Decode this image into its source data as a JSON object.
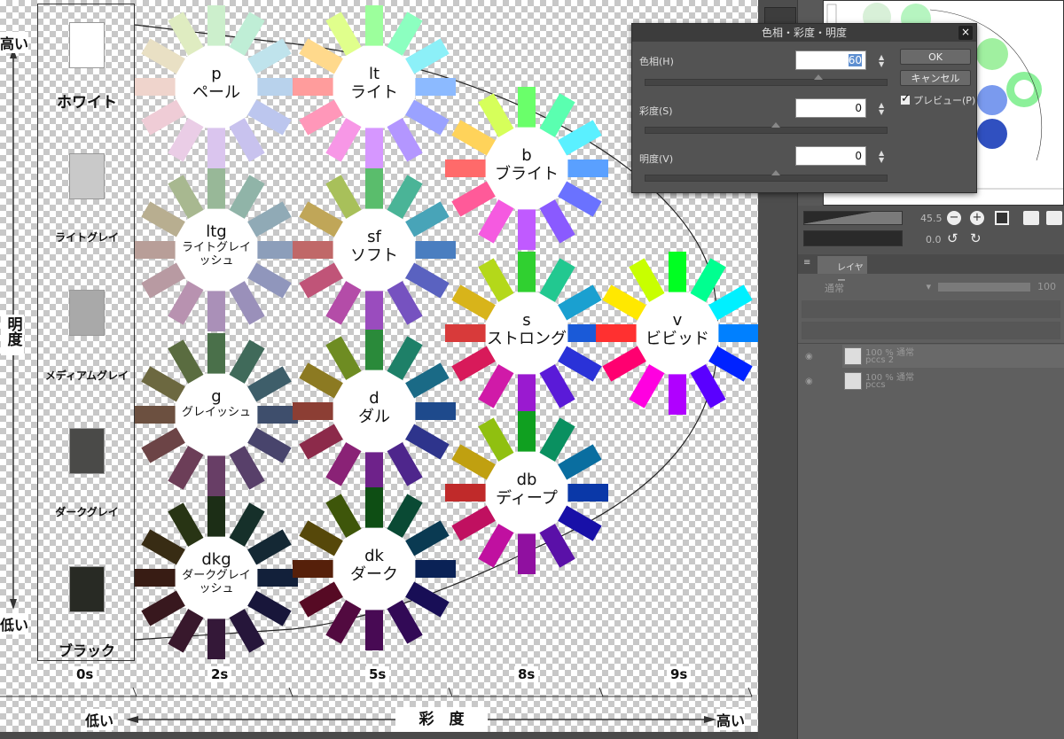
{
  "canvas": {
    "brightness_axis": {
      "high": "高い",
      "low": "低い",
      "label": "明度"
    },
    "saturation_axis": {
      "low": "低い",
      "high": "高い",
      "label": "彩　度"
    },
    "scale_labels": [
      "0s",
      "2s",
      "5s",
      "8s",
      "9s"
    ],
    "grays": [
      {
        "label": "ホワイト",
        "color": "#ffffff"
      },
      {
        "label": "ライトグレイ",
        "color": "#c9c9c9"
      },
      {
        "label": "メディアムグレイ",
        "color": "#a9a9a9"
      },
      {
        "label": "ダークグレイ",
        "color": "#4a4a48"
      },
      {
        "label": "ブラック",
        "color": "#282a24"
      }
    ],
    "tones": [
      {
        "code": "p",
        "name": "ペール",
        "colors": [
          "#ccefcc",
          "#bfeed6",
          "#bfe3ec",
          "#b8d2ec",
          "#bcc6ee",
          "#c8c2ee",
          "#dac5ee",
          "#eacde6",
          "#efccd6",
          "#efd4cc",
          "#e9e0c4",
          "#dfecc1"
        ]
      },
      {
        "code": "lt",
        "name": "ライト",
        "colors": [
          "#9cff9c",
          "#8cffc0",
          "#8cf0f8",
          "#8cbaff",
          "#9aa2ff",
          "#b396ff",
          "#d697ff",
          "#f797e6",
          "#ff97b9",
          "#ff9c9c",
          "#ffd98c",
          "#e0ff8c"
        ]
      },
      {
        "code": "b",
        "name": "ブライト",
        "colors": [
          "#6aff6a",
          "#5affb0",
          "#5af0ff",
          "#5aa0ff",
          "#6a72ff",
          "#8a5aff",
          "#c05aff",
          "#f55ae0",
          "#ff5a99",
          "#ff6a6a",
          "#ffd35a",
          "#d6ff5a"
        ]
      },
      {
        "code": "ltg",
        "name": "ライトグレイッシュ",
        "small": true,
        "colors": [
          "#98b898",
          "#90b4a8",
          "#90aab6",
          "#8c9eba",
          "#9096bc",
          "#9a90ba",
          "#aa90b8",
          "#b892b0",
          "#b89aa2",
          "#b89e98",
          "#b8ae90",
          "#a8b890"
        ]
      },
      {
        "code": "sf",
        "name": "ソフト",
        "colors": [
          "#5abd6c",
          "#4ab497",
          "#48a4b8",
          "#4a7ec0",
          "#5a62c0",
          "#7652c0",
          "#9a4cbe",
          "#b44ca8",
          "#c05478",
          "#c06868",
          "#c0a658",
          "#a8c05a"
        ]
      },
      {
        "code": "s",
        "name": "ストロング",
        "colors": [
          "#30d030",
          "#22c890",
          "#1aa0d0",
          "#1a5ad8",
          "#2a32d8",
          "#5a1ad8",
          "#9a1ad0",
          "#d01aa8",
          "#d81a5a",
          "#d83a3a",
          "#d8b41a",
          "#b4d81a"
        ]
      },
      {
        "code": "v",
        "name": "ビビッド",
        "colors": [
          "#00ff22",
          "#00ff90",
          "#00f0ff",
          "#0080ff",
          "#0022ff",
          "#5a00ff",
          "#b000ff",
          "#ff00e0",
          "#ff0070",
          "#ff3030",
          "#ffe800",
          "#c8ff00"
        ]
      },
      {
        "code": "g",
        "name": "グレイッシュ",
        "small": true,
        "colors": [
          "#4a704a",
          "#406a5a",
          "#3e5e6a",
          "#3e4e6c",
          "#48446c",
          "#58406a",
          "#683e66",
          "#6c3e58",
          "#6c4446",
          "#6c5040",
          "#6c6840",
          "#5a6c40"
        ]
      },
      {
        "code": "d",
        "name": "ダル",
        "colors": [
          "#2a8a3a",
          "#1e8068",
          "#1a6a86",
          "#1e4a8c",
          "#2e348c",
          "#4e268c",
          "#6e228a",
          "#8a2276",
          "#8c2a4a",
          "#8c3e34",
          "#8c7a22",
          "#6e8c22"
        ]
      },
      {
        "code": "db",
        "name": "ディープ",
        "colors": [
          "#10a020",
          "#0a9060",
          "#0a6ea0",
          "#0a38a8",
          "#1810a8",
          "#5a10a8",
          "#9010a0",
          "#c010a0",
          "#c01060",
          "#c02a2a",
          "#c0a010",
          "#90c010"
        ]
      },
      {
        "code": "dkg",
        "name": "ダークグレイッシュ",
        "small": true,
        "colors": [
          "#1c2e16",
          "#16302a",
          "#142834",
          "#12203a",
          "#18163a",
          "#26163a",
          "#341838",
          "#38182c",
          "#38181e",
          "#381c14",
          "#382c14",
          "#283414"
        ]
      },
      {
        "code": "dk",
        "name": "ダーク",
        "colors": [
          "#0e4e14",
          "#0a4a34",
          "#0a3a52",
          "#0a2256",
          "#180e56",
          "#320a56",
          "#480a54",
          "#520a40",
          "#560a24",
          "#56200a",
          "#56480a",
          "#3e560a"
        ]
      }
    ]
  },
  "dialog": {
    "title": "色相・彩度・明度",
    "close": "×",
    "fields": [
      {
        "label": "色相(H)",
        "value": "60"
      },
      {
        "label": "彩度(S)",
        "value": "0"
      },
      {
        "label": "明度(V)",
        "value": "0"
      }
    ],
    "ok": "OK",
    "cancel": "キャンセル",
    "preview": "プレビュー(P)"
  },
  "brush": {
    "size": "45.5",
    "opacity": "0.0"
  },
  "layers": {
    "tab": "レイヤー",
    "blend": "通常",
    "opacity": "100",
    "items": [
      {
        "line1": "100 % 通常",
        "line2": "pccs 2"
      },
      {
        "line1": "100 % 通常",
        "line2": "pccs"
      }
    ]
  }
}
